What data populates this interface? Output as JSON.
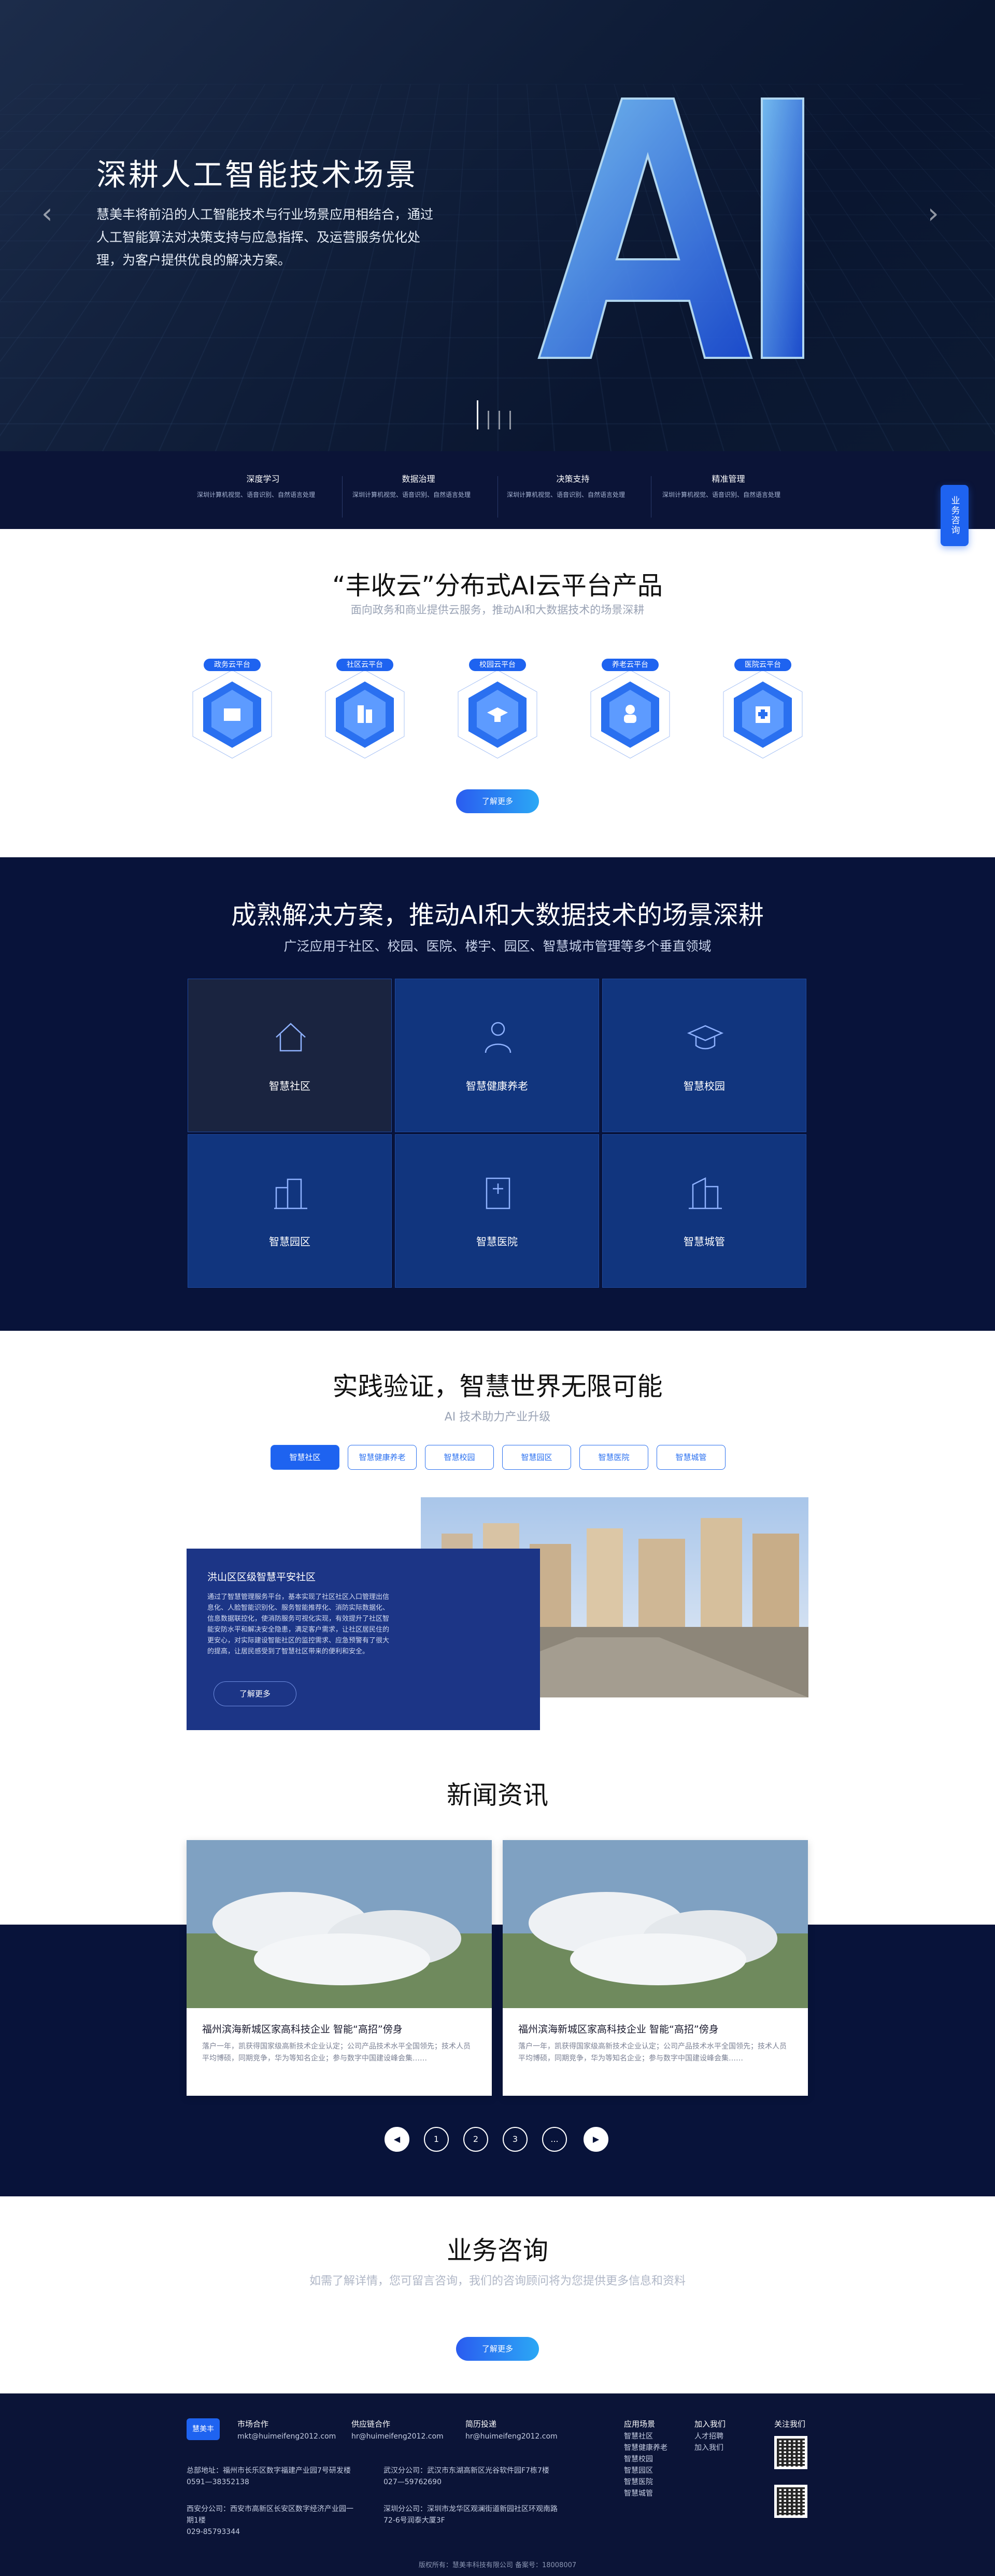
{
  "hero": {
    "title": "深耕人工智能技术场景",
    "desc": "慧美丰将前沿的人工智能技术与行业场景应用相结合，通过人工智能算法对决策支持与应急指挥、及运营服务优化处理，为客户提供优良的解决方案。",
    "prev_icon": "chevron-left-icon",
    "next_icon": "chevron-right-icon",
    "slides": 4,
    "active_slide": 1
  },
  "features": [
    {
      "title": "深度学习",
      "desc": "深圳计算机视觉、语音识别、自然语言处理"
    },
    {
      "title": "数据治理",
      "desc": "深圳计算机视觉、语音识别、自然语言处理"
    },
    {
      "title": "决策支持",
      "desc": "深圳计算机视觉、语音识别、自然语言处理"
    },
    {
      "title": "精准管理",
      "desc": "深圳计算机视觉、语音识别、自然语言处理"
    }
  ],
  "side_button": "业务咨询",
  "platform": {
    "title": "“丰收云”分布式AI云平台产品",
    "subtitle": "面向政务和商业提供云服务，推动AI和大数据技术的场景深耕",
    "items": [
      {
        "label": "政务云平台",
        "icon": "government-icon"
      },
      {
        "label": "社区云平台",
        "icon": "community-icon"
      },
      {
        "label": "校园云平台",
        "icon": "campus-icon"
      },
      {
        "label": "养老云平台",
        "icon": "elderly-icon"
      },
      {
        "label": "医院云平台",
        "icon": "hospital-icon"
      }
    ],
    "more": "了解更多"
  },
  "solutions": {
    "title": "成熟解决方案，推动AI和大数据技术的场景深耕",
    "subtitle": "广泛应用于社区、校园、医院、楼宇、园区、智慧城市管理等多个垂直领域",
    "tiles": [
      {
        "label": "智慧社区"
      },
      {
        "label": "智慧健康养老"
      },
      {
        "label": "智慧校园"
      },
      {
        "label": "智慧园区"
      },
      {
        "label": "智慧医院"
      },
      {
        "label": "智慧城管"
      }
    ]
  },
  "cases": {
    "title": "实践验证，智慧世界无限可能",
    "subtitle": "AI 技术助力产业升级",
    "tabs": [
      "智慧社区",
      "智慧健康养老",
      "智慧校园",
      "智慧园区",
      "智慧医院",
      "智慧城管"
    ],
    "active_tab": 0,
    "case_title": "洪山区区级智慧平安社区",
    "case_desc": "通过了智慧管理服务平台，基本实现了社区社区入口管理出信息化、人脸智能识别化、服务智能推荐化、消防实际数据化、信息数据联控化，使消防服务可视化实现，有效提升了社区智能安防水平和解决安全隐患，满足客户需求，让社区居民住的更安心，对实际建设智能社区的监控需求、应急预警有了很大的提高，让居民感受到了智慧社区带来的便利和安全。",
    "more": "了解更多"
  },
  "news": {
    "title": "新闻资讯",
    "items": [
      {
        "title": "福州滨海新城区家高科技企业 智能“高招”傍身",
        "desc": "落户一年，凯获得国家级高新技术企业认定；公司产品技术水平全国领先；技术人员平均博硕，同期竞争，华为等知名企业；参与数字中国建设峰会集……"
      },
      {
        "title": "福州滨海新城区家高科技企业 智能“高招”傍身",
        "desc": "落户一年，凯获得国家级高新技术企业认定；公司产品技术水平全国领先；技术人员平均博硕，同期竞争，华为等知名企业；参与数字中国建设峰会集……"
      }
    ],
    "pages": [
      "1",
      "2",
      "3",
      "..."
    ],
    "prev_icon": "prev-arrow-icon",
    "next_icon": "next-arrow-icon"
  },
  "consult": {
    "title": "业务咨询",
    "subtitle": "如需了解详情，您可留言咨询，我们的咨询顾问将为您提供更多信息和资料",
    "button": "了解更多"
  },
  "footer": {
    "logo": "慧美丰",
    "contacts": [
      {
        "title": "市场合作",
        "value": "mkt@huimeifeng2012.com"
      },
      {
        "title": "供应链合作",
        "value": "hr@huimeifeng2012.com"
      },
      {
        "title": "简历投递",
        "value": "hr@huimeifeng2012.com"
      }
    ],
    "offices": [
      {
        "name": "总部地址：福州市长乐区数字福建产业园7号研发楼",
        "phone": "0591—38352138"
      },
      {
        "name": "武汉分公司：武汉市东湖高新区光谷软件园F7栋7楼",
        "phone": "027—59762690"
      },
      {
        "name": "西安分公司：西安市高新区长安区数字经济产业园一期1楼",
        "phone": "029-85793344"
      },
      {
        "name": "深圳分公司：深圳市龙华区观澜街道新园社区环观南路72-6号润泰大厦3F",
        "phone": ""
      }
    ],
    "nav_title": "应用场景",
    "nav": [
      "智慧社区",
      "智慧健康养老",
      "智慧校园",
      "智慧园区",
      "智慧医院",
      "智慧城管"
    ],
    "join_title": "加入我们",
    "join": [
      "人才招聘",
      "加入我们"
    ],
    "follow_title": "关注我们",
    "copyright": "版权所有：慧美丰科技有限公司  备案号：18008007"
  },
  "colors": {
    "primary": "#1e63f0",
    "navy": "#08133a",
    "tile": "#11357e"
  }
}
